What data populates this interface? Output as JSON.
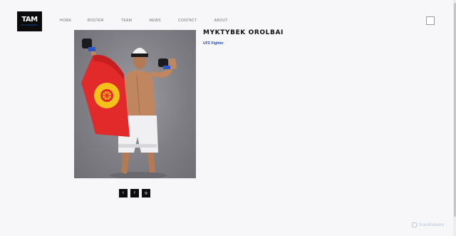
{
  "header": {
    "logo_text": "TAM",
    "logo_sub": "MANAGEMENT",
    "nav": [
      "HOME",
      "ROSTER",
      "TEAM",
      "NEWS",
      "CONTACT",
      "ABOUT"
    ]
  },
  "fighter": {
    "name": "MYKTYBEK OROLBAI",
    "title": "UFC Fighter"
  },
  "social": {
    "twitter_glyph": "t",
    "facebook_glyph": "f",
    "instagram_glyph": "◎"
  },
  "watermark": "ScanMalware",
  "colors": {
    "accent_blue": "#1f47b8",
    "flag_red": "#e22a2a",
    "flag_yellow": "#f4c21a",
    "background": "#f7f7f9"
  }
}
